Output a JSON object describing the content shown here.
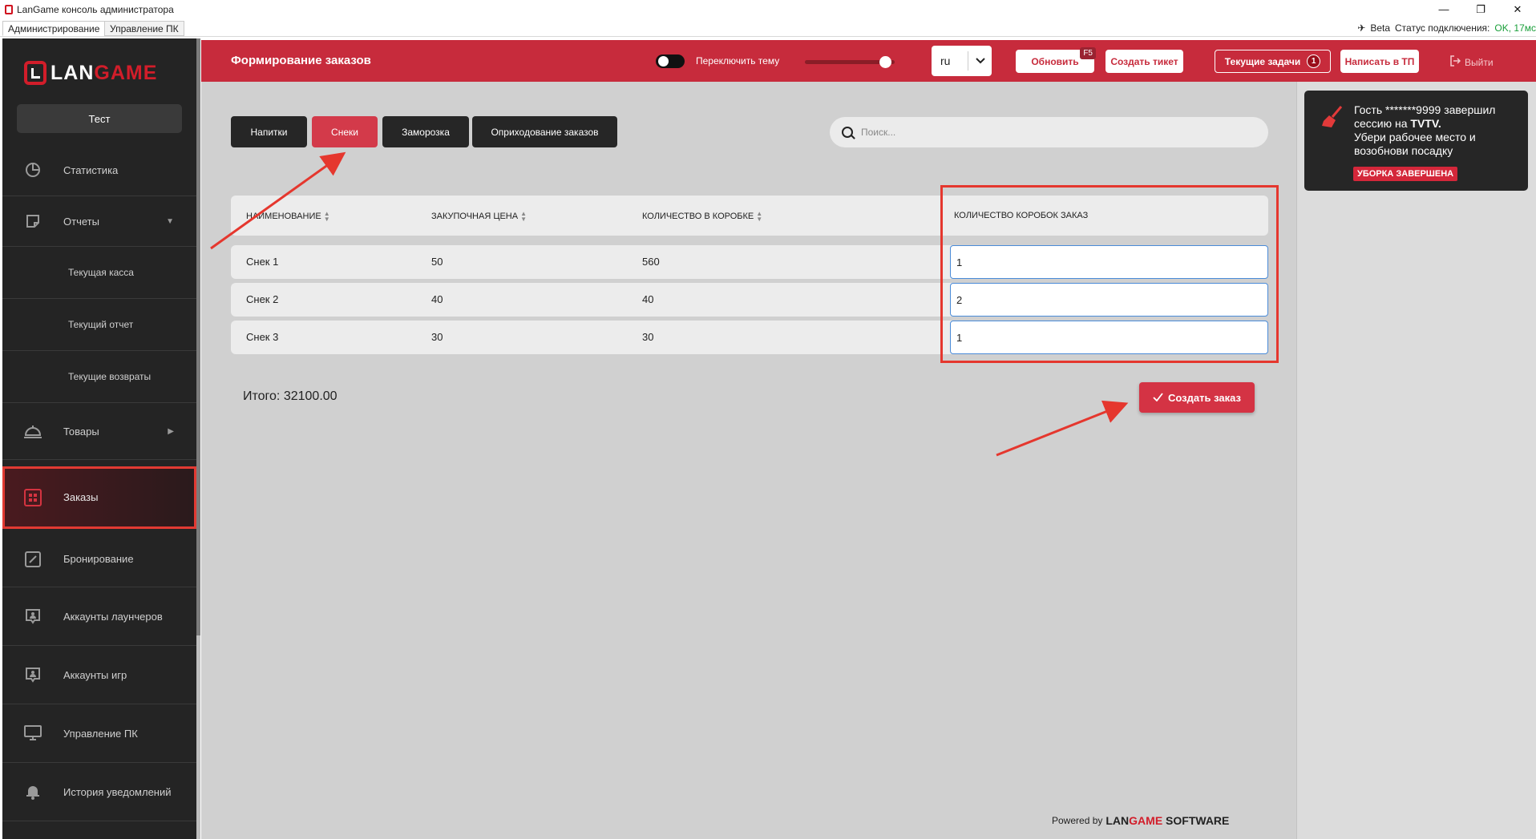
{
  "window": {
    "title": "LanGame консоль администратора",
    "controls": [
      "—",
      "❐",
      "✕"
    ]
  },
  "menubar": {
    "tabs": [
      {
        "label": "Администрирование",
        "active": true
      },
      {
        "label": "Управление ПК",
        "active": false
      }
    ],
    "beta_label": "Beta",
    "connection_label": "Статус подключения:",
    "connection_value": "OK, 17мс"
  },
  "sidebar": {
    "logo": {
      "text_white": "LAN",
      "text_red": "GAME"
    },
    "club_button": "Тест",
    "items": [
      {
        "label": "Статистика",
        "icon": "pie-chart-icon"
      },
      {
        "label": "Отчеты",
        "icon": "report-icon",
        "caret": "▼"
      },
      {
        "label": "Текущая касса"
      },
      {
        "label": "Текущий отчет"
      },
      {
        "label": "Текущие возвраты"
      },
      {
        "label": "Товары",
        "icon": "service-bell-icon",
        "caret": "▶"
      },
      {
        "label": "Заказы",
        "icon": "orders-grid-icon",
        "active": true
      },
      {
        "label": "Бронирование",
        "icon": "edit-icon"
      },
      {
        "label": "Аккаунты лаунчеров",
        "icon": "account-icon"
      },
      {
        "label": "Аккаунты игр",
        "icon": "account-icon"
      },
      {
        "label": "Управление ПК",
        "icon": "monitor-icon"
      },
      {
        "label": "История уведомлений",
        "icon": "bell-icon"
      }
    ]
  },
  "header": {
    "title": "Формирование заказов",
    "theme_toggle_label": "Переключить тему",
    "language": "ru",
    "refresh_label": "Обновить",
    "refresh_hotkey": "F5",
    "create_ticket_label": "Создать тикет",
    "current_tasks_label": "Текущие задачи",
    "current_tasks_count": "1",
    "write_support_label": "Написать в ТП",
    "logout_label": "Выйти"
  },
  "tabs": [
    {
      "label": "Напитки",
      "active": false
    },
    {
      "label": "Снеки",
      "active": true
    },
    {
      "label": "Заморозка",
      "active": false
    },
    {
      "label": "Оприходование заказов",
      "active": false
    }
  ],
  "search": {
    "placeholder": "Поиск..."
  },
  "table": {
    "columns": [
      "НАИМЕНОВАНИЕ",
      "ЗАКУПОЧНАЯ ЦЕНА",
      "КОЛИЧЕСТВО В КОРОБКЕ",
      "КОЛИЧЕСТВО КОРОБОК ЗАКАЗ"
    ],
    "rows": [
      {
        "name": "Снек 1",
        "price": "50",
        "per_box": "560",
        "boxes": "1"
      },
      {
        "name": "Снек 2",
        "price": "40",
        "per_box": "40",
        "boxes": "2"
      },
      {
        "name": "Снек 3",
        "price": "30",
        "per_box": "30",
        "boxes": "1"
      }
    ]
  },
  "total_label": "Итого: 32100.00",
  "create_order_label": "Создать заказ",
  "footer": {
    "powered_by": "Powered by",
    "brand_white": "LAN",
    "brand_red": "GAME",
    "brand_suffix": "SOFTWARE"
  },
  "notification": {
    "message_prefix": "Гость *******9999 завершил сессию на ",
    "pc_name": "TVTV.",
    "message_suffix": "Убери рабочее место и возобнови посадку",
    "button": "УБОРКА ЗАВЕРШЕНА"
  },
  "colors": {
    "accent": "#c72b3c",
    "sidebar": "#242424",
    "annotation": "#e5372e"
  }
}
